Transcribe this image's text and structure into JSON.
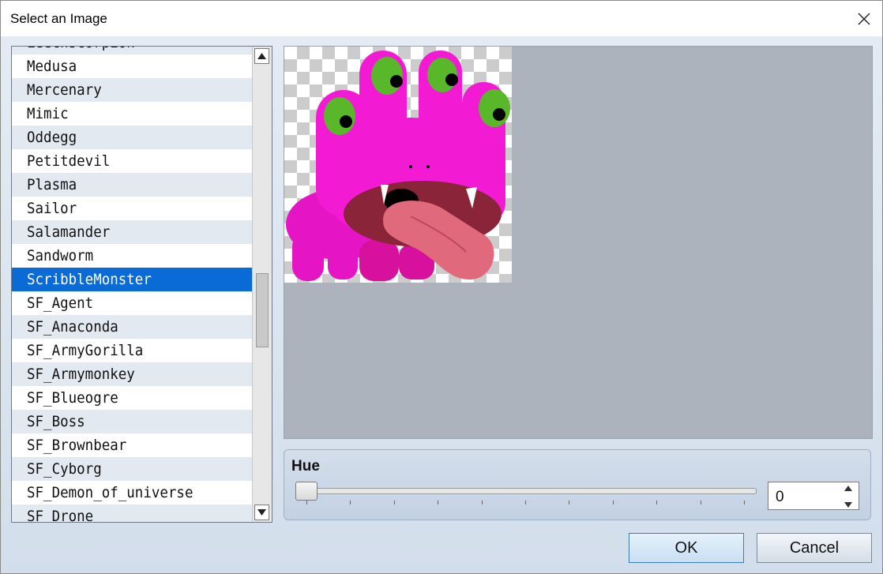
{
  "window": {
    "title": "Select an Image"
  },
  "list": {
    "items": [
      "Leechscorpion",
      "Medusa",
      "Mercenary",
      "Mimic",
      "Oddegg",
      "Petitdevil",
      "Plasma",
      "Sailor",
      "Salamander",
      "Sandworm",
      "ScribbleMonster",
      "SF_Agent",
      "SF_Anaconda",
      "SF_ArmyGorilla",
      "SF_Armymonkey",
      "SF_Blueogre",
      "SF_Boss",
      "SF_Brownbear",
      "SF_Cyborg",
      "SF_Demon_of_universe",
      "SF_Drone"
    ],
    "selected": "ScribbleMonster"
  },
  "hue": {
    "label": "Hue",
    "value": "0"
  },
  "buttons": {
    "ok": "OK",
    "cancel": "Cancel"
  },
  "colors": {
    "selection": "#0a6ad6",
    "preview_bg": "#adb3bd",
    "monster": "#f018c8"
  },
  "icons": {
    "close": "close-icon",
    "scroll_up": "arrow-up-icon",
    "scroll_down": "arrow-down-icon"
  }
}
